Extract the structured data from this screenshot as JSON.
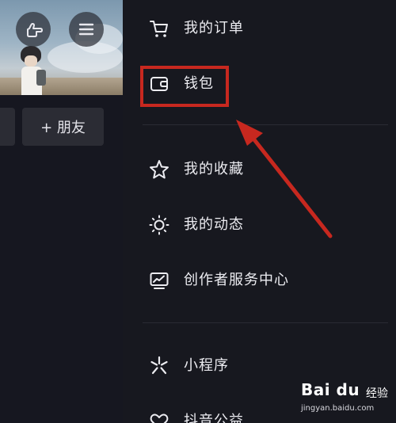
{
  "left_panel": {
    "add_friend_label": "+ 朋友"
  },
  "drawer": {
    "items": [
      {
        "label": "我的订单",
        "icon": "cart-icon"
      },
      {
        "label": "钱包",
        "icon": "wallet-icon"
      },
      {
        "label": "我的收藏",
        "icon": "star-icon"
      },
      {
        "label": "我的动态",
        "icon": "sun-icon"
      },
      {
        "label": "创作者服务中心",
        "icon": "monitor-chart-icon"
      },
      {
        "label": "小程序",
        "icon": "mini-program-icon"
      },
      {
        "label": "抖音公益",
        "icon": "heart-icon"
      }
    ]
  },
  "annotation": {
    "highlighted_item": "钱包",
    "color": "#c7281f"
  },
  "watermark": {
    "brand": "Bai du",
    "jingyan": "经验",
    "site": "jingyan.baidu.com"
  }
}
